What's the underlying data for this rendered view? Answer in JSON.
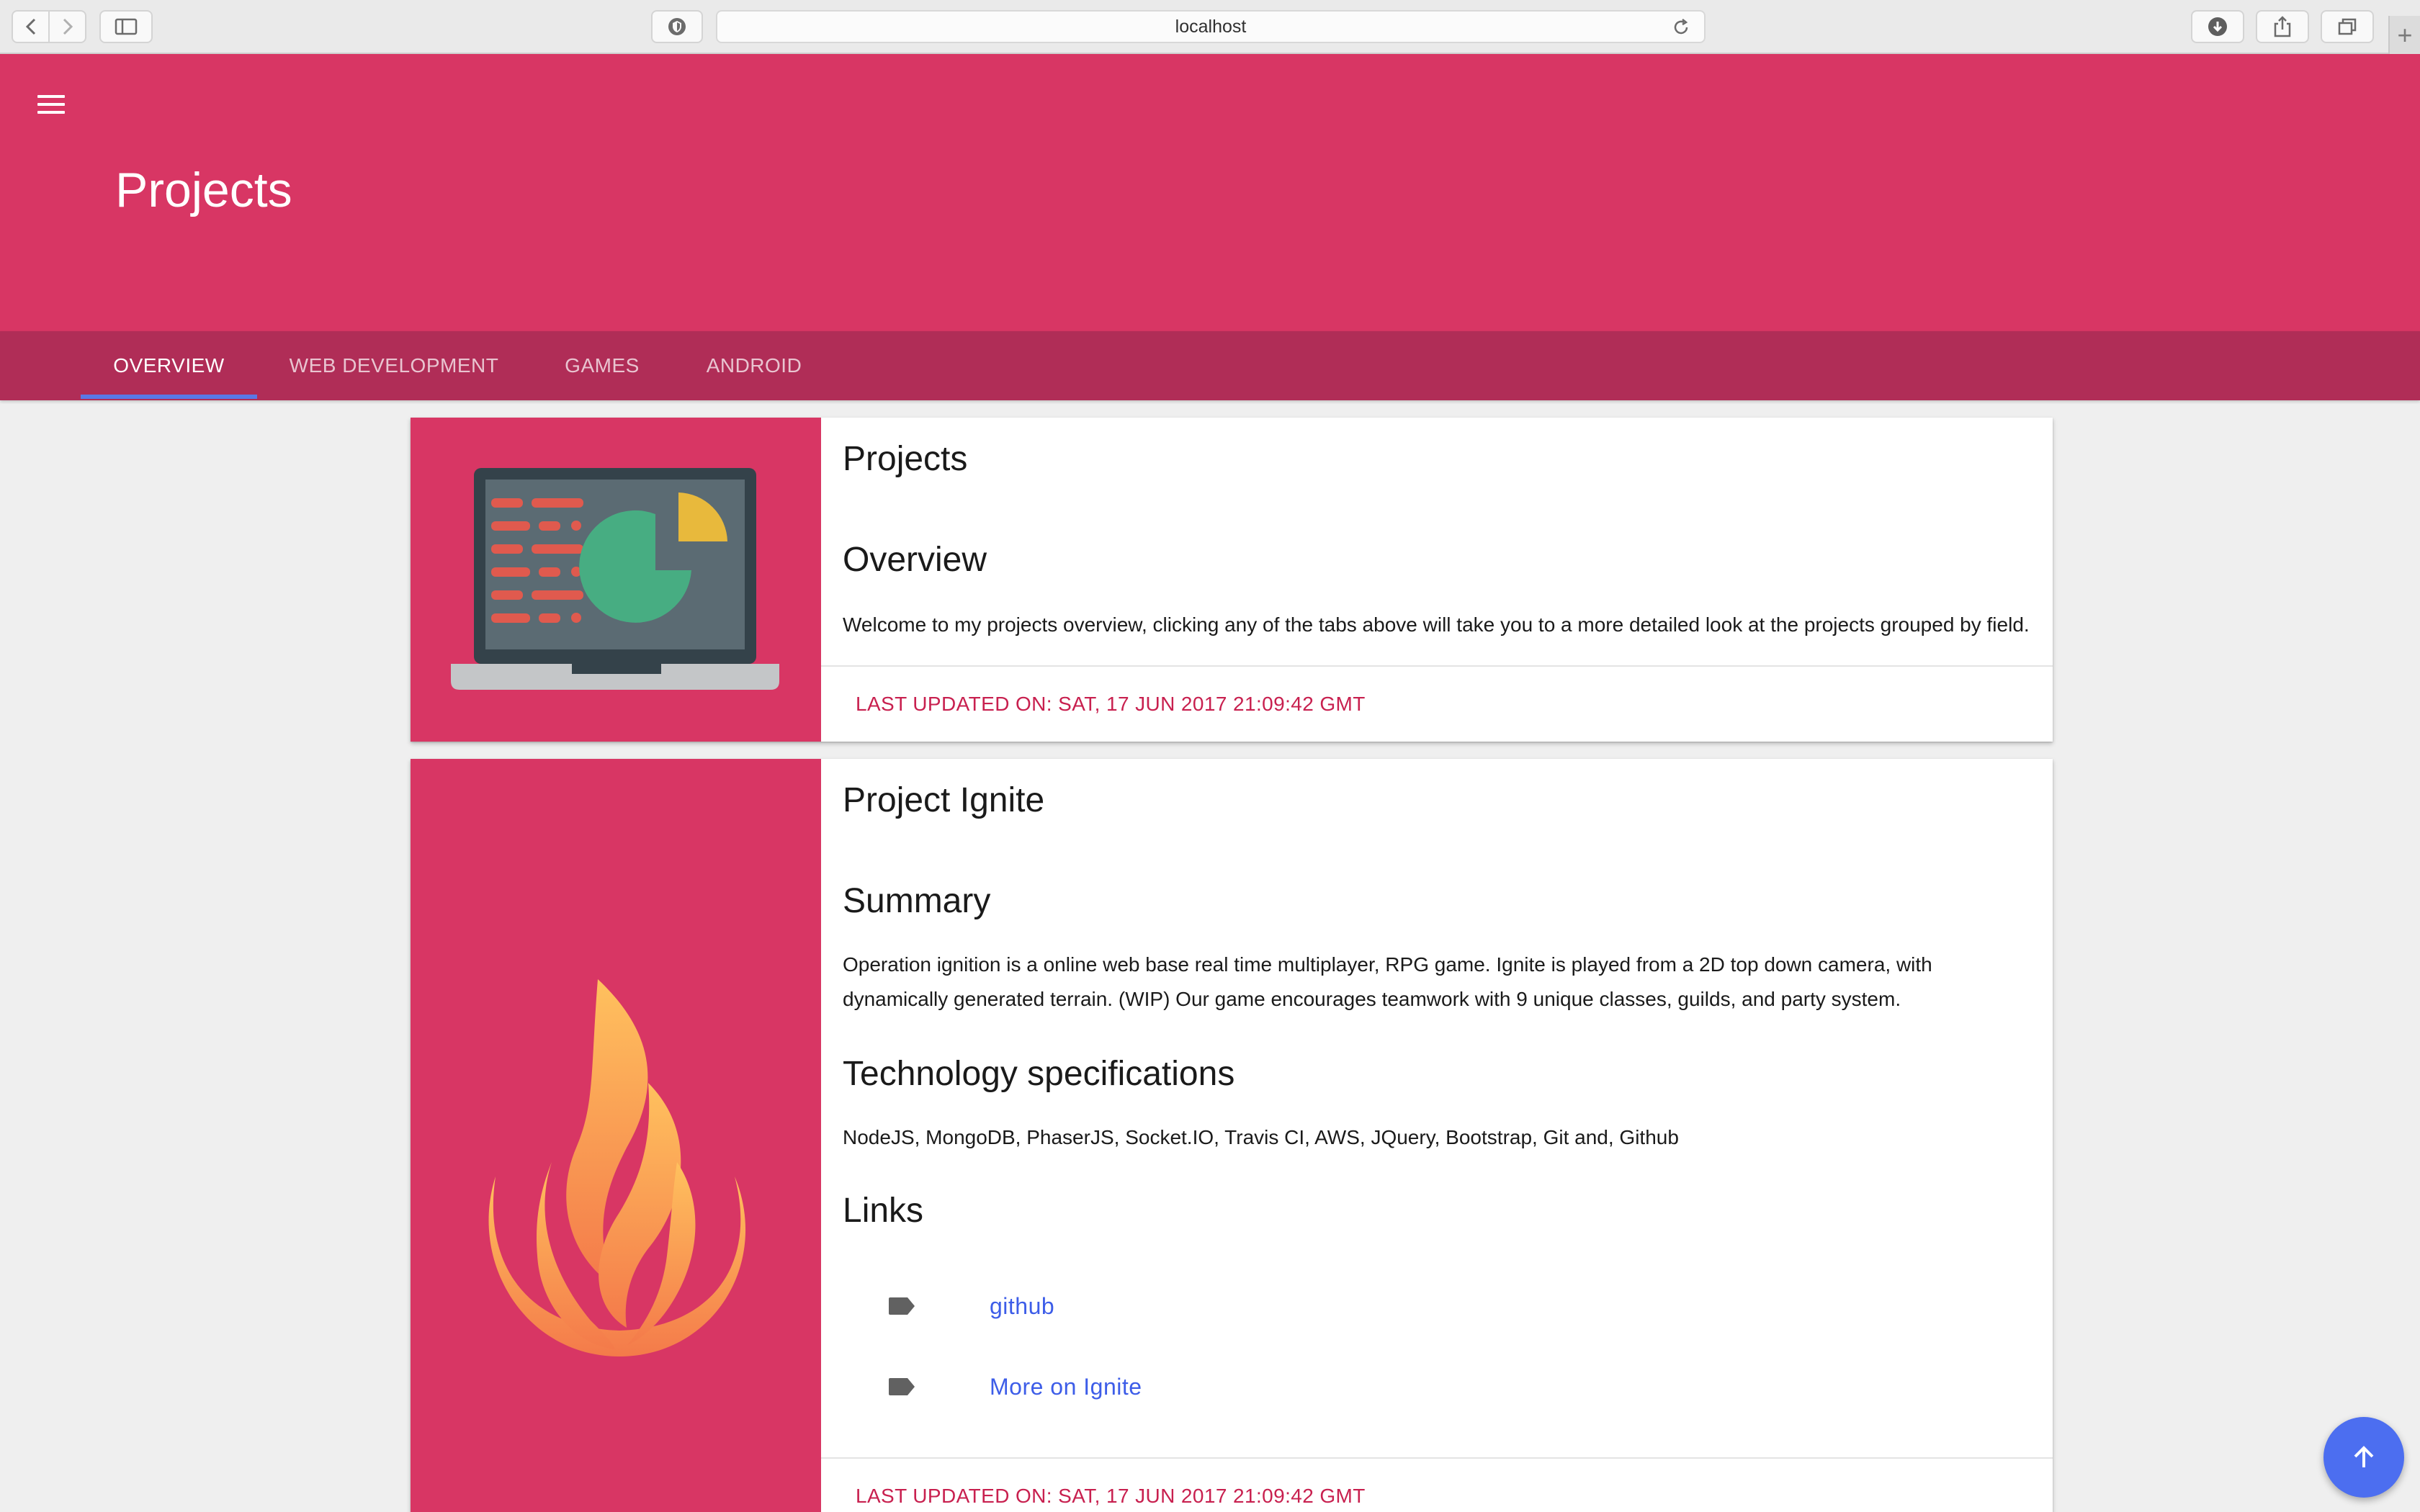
{
  "browser": {
    "url": "localhost"
  },
  "header": {
    "title": "Projects"
  },
  "tabs": [
    {
      "label": "OVERVIEW",
      "active": true
    },
    {
      "label": "WEB DEVELOPMENT",
      "active": false
    },
    {
      "label": "GAMES",
      "active": false
    },
    {
      "label": "ANDROID",
      "active": false
    }
  ],
  "cards": [
    {
      "title": "Projects",
      "sections": [
        {
          "heading": "Overview",
          "text": "Welcome to my projects overview, clicking any of the tabs above will take you to a more detailed look at the projects grouped by field."
        }
      ],
      "updated": "LAST UPDATED ON: SAT, 17 JUN 2017 21:09:42 GMT",
      "media_icon": "laptop-chart-icon"
    },
    {
      "title": "Project Ignite",
      "sections": [
        {
          "heading": "Summary",
          "text": "Operation ignition is a online web base real time multiplayer, RPG game. Ignite is played from a 2D top down camera, with dynamically generated terrain. (WIP) Our game encourages teamwork with 9 unique classes, guilds, and party system."
        },
        {
          "heading": "Technology specifications",
          "text": "NodeJS, MongoDB, PhaserJS, Socket.IO, Travis CI, AWS, JQuery, Bootstrap, Git and, Github"
        },
        {
          "heading": "Links",
          "text": ""
        }
      ],
      "links": [
        {
          "label": "github",
          "icon": "label-tag-icon"
        },
        {
          "label": "More on Ignite",
          "icon": "label-tag-icon"
        }
      ],
      "updated": "LAST UPDATED ON: SAT, 17 JUN 2017 21:09:42 GMT",
      "media_icon": "flame-icon"
    }
  ],
  "colors": {
    "primary": "#d83664",
    "primary_dark": "#b02d57",
    "accent": "#4c6ef0",
    "link": "#3d5de8",
    "updated_text": "#c8204f"
  }
}
